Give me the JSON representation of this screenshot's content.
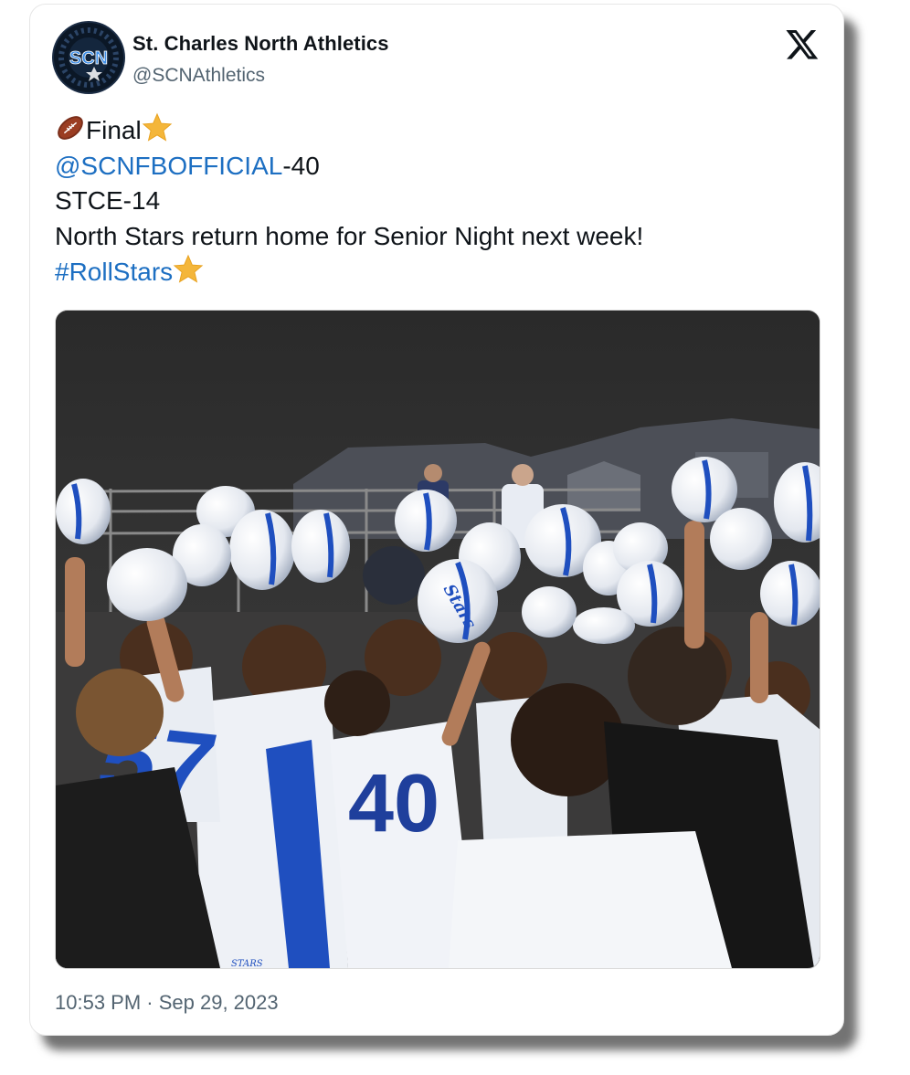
{
  "author": {
    "display_name": "St. Charles North Athletics",
    "handle": "@SCNAthletics",
    "avatar_text": "SCN"
  },
  "platform": {
    "logo_icon": "x-logo-icon"
  },
  "tweet": {
    "line1_text": "Final",
    "line1_icons": [
      "football-emoji-icon",
      "star-emoji-icon"
    ],
    "line2_mention": "@SCNFBOFFICIAL",
    "line2_score": "-40",
    "line3": "STCE-14",
    "line4": "North Stars return home for Senior Night next week!",
    "line5_hashtag": "#RollStars",
    "line5_icon": "star-emoji-icon"
  },
  "media": {
    "photo_text": "football team celebration photo",
    "visible_jersey_numbers": [
      "57",
      "40"
    ],
    "helmet_text": "Stars",
    "pants_text": "STARS"
  },
  "timestamp": "10:53 PM · Sep 29, 2023",
  "colors": {
    "link": "#1d6fc2",
    "text": "#0f1419",
    "muted": "#536471",
    "star": "#f4b63a",
    "team_blue": "#1f4fbf"
  }
}
